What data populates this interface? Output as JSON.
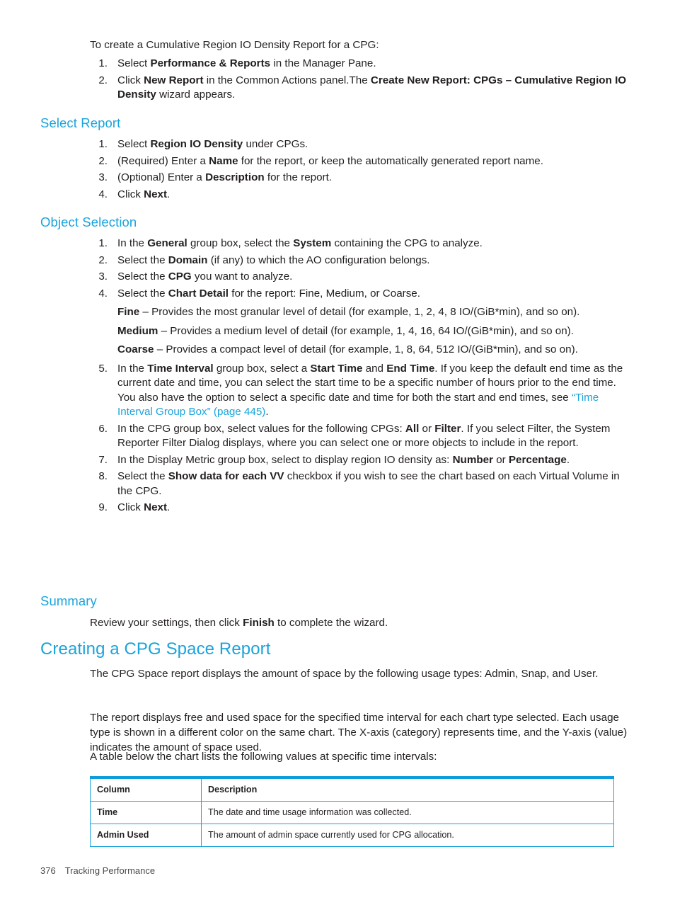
{
  "intro": {
    "lead": "To create a Cumulative Region IO Density Report for a CPG:",
    "steps": [
      {
        "num": "1.",
        "parts": [
          {
            "t": "Select ",
            "b": false
          },
          {
            "t": "Performance & Reports",
            "b": true
          },
          {
            "t": " in the Manager Pane.",
            "b": false
          }
        ]
      },
      {
        "num": "2.",
        "parts": [
          {
            "t": "Click ",
            "b": false
          },
          {
            "t": "New Report",
            "b": true
          },
          {
            "t": " in the Common Actions panel.The ",
            "b": false
          },
          {
            "t": "Create New Report: CPGs – Cumulative Region IO Density",
            "b": true
          },
          {
            "t": " wizard appears.",
            "b": false
          }
        ]
      }
    ]
  },
  "select_report": {
    "heading": "Select Report",
    "steps": [
      {
        "num": "1.",
        "parts": [
          {
            "t": "Select ",
            "b": false
          },
          {
            "t": "Region IO Density",
            "b": true
          },
          {
            "t": " under CPGs.",
            "b": false
          }
        ]
      },
      {
        "num": "2.",
        "parts": [
          {
            "t": "(Required) Enter a ",
            "b": false
          },
          {
            "t": "Name",
            "b": true
          },
          {
            "t": " for the report, or keep the automatically generated report name.",
            "b": false
          }
        ]
      },
      {
        "num": "3.",
        "parts": [
          {
            "t": "(Optional) Enter a ",
            "b": false
          },
          {
            "t": "Description",
            "b": true
          },
          {
            "t": " for the report.",
            "b": false
          }
        ]
      },
      {
        "num": "4.",
        "parts": [
          {
            "t": "Click ",
            "b": false
          },
          {
            "t": "Next",
            "b": true
          },
          {
            "t": ".",
            "b": false
          }
        ]
      }
    ]
  },
  "object_selection": {
    "heading": "Object Selection",
    "steps": [
      {
        "num": "1.",
        "parts": [
          {
            "t": "In the ",
            "b": false
          },
          {
            "t": "General",
            "b": true
          },
          {
            "t": " group box, select the ",
            "b": false
          },
          {
            "t": "System",
            "b": true
          },
          {
            "t": " containing the CPG to analyze.",
            "b": false
          }
        ]
      },
      {
        "num": "2.",
        "parts": [
          {
            "t": "Select the ",
            "b": false
          },
          {
            "t": "Domain",
            "b": true
          },
          {
            "t": " (if any) to which the AO configuration belongs.",
            "b": false
          }
        ]
      },
      {
        "num": "3.",
        "parts": [
          {
            "t": "Select the ",
            "b": false
          },
          {
            "t": "CPG",
            "b": true
          },
          {
            "t": " you want to analyze.",
            "b": false
          }
        ]
      },
      {
        "num": "4.",
        "parts": [
          {
            "t": "Select the ",
            "b": false
          },
          {
            "t": "Chart Detail",
            "b": true
          },
          {
            "t": " for the report: Fine, Medium, or Coarse.",
            "b": false
          }
        ],
        "subparas": [
          [
            {
              "t": "Fine",
              "b": true
            },
            {
              "t": " – Provides the most granular level of detail (for example, 1, 2, 4, 8 IO/(GiB*min), and so on).",
              "b": false
            }
          ],
          [
            {
              "t": "Medium",
              "b": true
            },
            {
              "t": " – Provides a medium level of detail (for example, 1, 4, 16, 64 IO/(GiB*min), and so on).",
              "b": false
            }
          ],
          [
            {
              "t": "Coarse",
              "b": true
            },
            {
              "t": " – Provides a compact level of detail (for example, 1, 8, 64, 512 IO/(GiB*min), and so on).",
              "b": false
            }
          ]
        ]
      },
      {
        "num": "5.",
        "parts": [
          {
            "t": "In the ",
            "b": false
          },
          {
            "t": "Time Interval",
            "b": true
          },
          {
            "t": " group box, select a ",
            "b": false
          },
          {
            "t": "Start Time",
            "b": true
          },
          {
            "t": " and ",
            "b": false
          },
          {
            "t": "End Time",
            "b": true
          },
          {
            "t": ". If you keep the default end time as the current date and time, you can select the start time to be a specific number of hours prior to the end time. You also have the option to select a specific date and time for both the start and end times, see ",
            "b": false
          },
          {
            "t": "“Time Interval Group Box” (page 445)",
            "b": false,
            "link": true
          },
          {
            "t": ".",
            "b": false
          }
        ]
      },
      {
        "num": "6.",
        "parts": [
          {
            "t": "In the CPG group box, select values for the following CPGs: ",
            "b": false
          },
          {
            "t": "All",
            "b": true
          },
          {
            "t": " or ",
            "b": false
          },
          {
            "t": "Filter",
            "b": true
          },
          {
            "t": ". If you select Filter, the System Reporter Filter Dialog displays, where you can select one or more objects to include in the report.",
            "b": false
          }
        ]
      },
      {
        "num": "7.",
        "parts": [
          {
            "t": "In the Display Metric group box, select to display region IO density as: ",
            "b": false
          },
          {
            "t": "Number",
            "b": true
          },
          {
            "t": " or ",
            "b": false
          },
          {
            "t": "Percentage",
            "b": true
          },
          {
            "t": ".",
            "b": false
          }
        ]
      },
      {
        "num": "8.",
        "parts": [
          {
            "t": "Select the ",
            "b": false
          },
          {
            "t": "Show data for each VV",
            "b": true
          },
          {
            "t": " checkbox if you wish to see the chart based on each Virtual Volume in the CPG.",
            "b": false
          }
        ]
      },
      {
        "num": "9.",
        "parts": [
          {
            "t": "Click ",
            "b": false
          },
          {
            "t": "Next",
            "b": true
          },
          {
            "t": ".",
            "b": false
          }
        ]
      }
    ]
  },
  "summary": {
    "heading": "Summary",
    "parts": [
      {
        "t": "Review your settings, then click ",
        "b": false
      },
      {
        "t": "Finish",
        "b": true
      },
      {
        "t": " to complete the wizard.",
        "b": false
      }
    ]
  },
  "cpg_space": {
    "heading": "Creating a CPG Space Report",
    "paragraphs": [
      "The CPG Space report displays the amount of space by the following usage types: Admin, Snap, and User.",
      "The report displays free and used space for the specified time interval for each chart type selected. Each usage type is shown in a different color on the same chart. The X-axis (category) represents time, and the Y-axis (value) indicates the amount of space used.",
      "A table below the chart lists the following values at specific time intervals:"
    ]
  },
  "table": {
    "headers": [
      "Column",
      "Description"
    ],
    "rows": [
      [
        "Time",
        "The date and time usage information was collected."
      ],
      [
        "Admin Used",
        "The amount of admin space currently used for CPG allocation."
      ]
    ]
  },
  "footer": {
    "page_number": "376",
    "chapter_title": "Tracking Performance"
  },
  "colors": {
    "heading_blue": "#1aa3dc",
    "body_text": "#231f20",
    "table_border": "#1aa3dc"
  }
}
